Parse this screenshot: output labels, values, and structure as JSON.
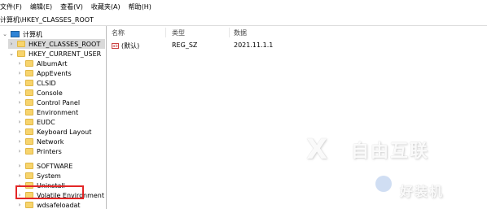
{
  "menu": [
    "文件(F)",
    "编辑(E)",
    "查看(V)",
    "收藏夹(A)",
    "帮助(H)"
  ],
  "address": "计算机\\HKEY_CLASSES_ROOT",
  "tree": {
    "root": "计算机",
    "items": [
      "HKEY_CLASSES_ROOT",
      "HKEY_CURRENT_USER",
      "AlbumArt",
      "AppEvents",
      "CLSID",
      "Console",
      "Control Panel",
      "Environment",
      "EUDC",
      "Keyboard Layout",
      "Network",
      "Printers",
      "SOFTWARE",
      "System",
      "Uninstall",
      "Volatile Environment",
      "wdsafeloadat"
    ]
  },
  "list": {
    "headers": [
      "名称",
      "类型",
      "数据"
    ],
    "rows": [
      {
        "name": "(默认)",
        "type": "REG_SZ",
        "data": "2021.11.1.1"
      }
    ]
  },
  "watermark": {
    "brand1": "自由互联",
    "brand2": "好装机"
  },
  "colors": {
    "highlight_box": "#e32626",
    "folder": "#f7d46d"
  }
}
